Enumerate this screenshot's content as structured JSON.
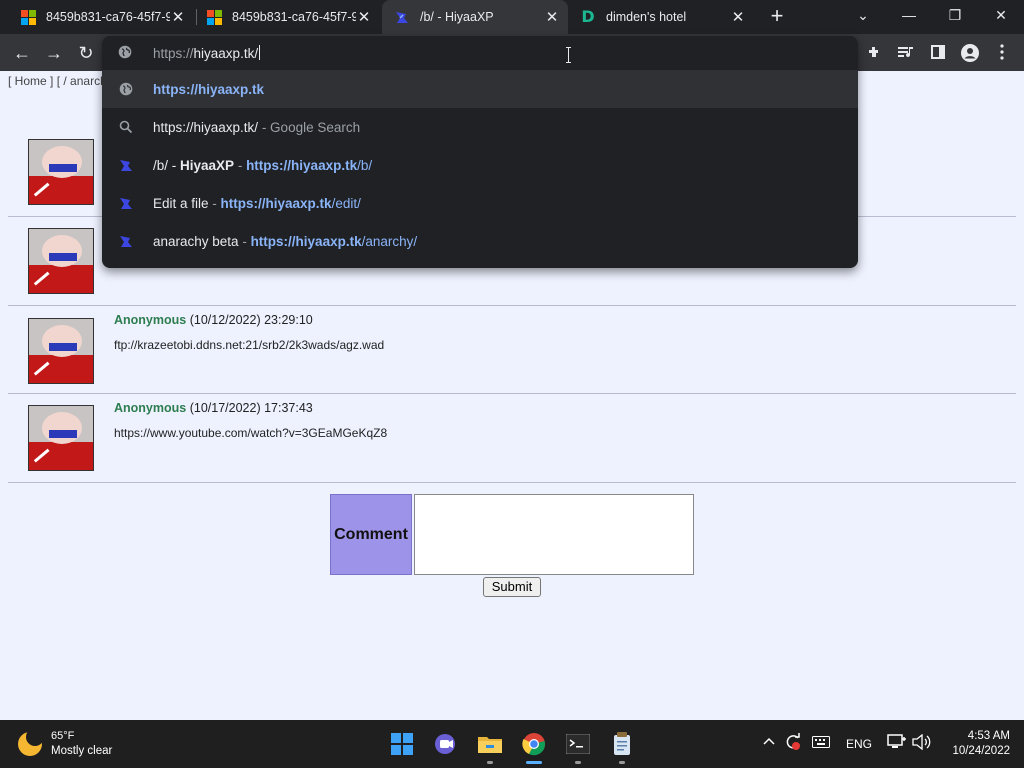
{
  "tabs": [
    {
      "title": "8459b831-ca76-45f7-9",
      "close": "✕",
      "favicon": "windows-logo"
    },
    {
      "title": "8459b831-ca76-45f7-9",
      "close": "✕",
      "favicon": "windows-logo"
    },
    {
      "title": "/b/ - HiyaaXP",
      "close": "✕",
      "favicon": "hiyaaxp-logo"
    },
    {
      "title": "dimden's hotel",
      "close": "✕",
      "favicon": "dimden-logo"
    }
  ],
  "new_tab": "+",
  "window_controls": {
    "chevron": "⌄",
    "minimize": "—",
    "restore": "❐",
    "close": "✕"
  },
  "toolbar": {
    "back": "←",
    "forward": "→",
    "reload": "↻"
  },
  "omnibox": {
    "prefix": "https://",
    "typed": "hiyaaxp.tk/",
    "suggestions": [
      {
        "icon": "globe-icon",
        "text": "https://hiyaaxp.tk"
      },
      {
        "icon": "search-icon",
        "query": "https://hiyaaxp.tk/",
        "suffix": " - Google Search"
      },
      {
        "icon": "hiyaaxp-logo",
        "title": "/b/ - HiyaaXP",
        "sep": " - ",
        "url_bold": "https://hiyaaxp.tk",
        "url_rest": "/b/"
      },
      {
        "icon": "hiyaaxp-logo",
        "title": "Edit a file",
        "sep": " - ",
        "url_bold": "https://hiyaaxp.tk",
        "url_rest": "/edit/"
      },
      {
        "icon": "hiyaaxp-logo",
        "title": "anarachy beta",
        "sep": " - ",
        "url_bold": "https://hiyaaxp.tk",
        "url_rest": "/anarchy/"
      }
    ]
  },
  "breadcrumb": {
    "home": "[ Home ]",
    "sep": "[ / ",
    "current": "anarcl"
  },
  "posts": [
    {
      "name": "",
      "date": "",
      "text": ""
    },
    {
      "name": "",
      "date": "",
      "text": ""
    },
    {
      "name": "Anonymous",
      "date": "(10/12/2022) 23:29:10",
      "text": "ftp://krazeetobi.ddns.net:21/srb2/2k3wads/agz.wad"
    },
    {
      "name": "Anonymous",
      "date": "(10/17/2022) 17:37:43",
      "text": "https://www.youtube.com/watch?v=3GEaMGeKqZ8"
    }
  ],
  "comment": {
    "label": "Comment",
    "value": "",
    "submit": "Submit"
  },
  "taskbar": {
    "weather_temp": "65°F",
    "weather_desc": "Mostly clear",
    "apps": [
      "windows-start-icon",
      "teams-chat-icon",
      "file-explorer-icon",
      "chrome-icon",
      "terminal-icon",
      "notepad-icon"
    ],
    "lang": "ENG",
    "time": "4:53 AM",
    "date": "10/24/2022"
  }
}
